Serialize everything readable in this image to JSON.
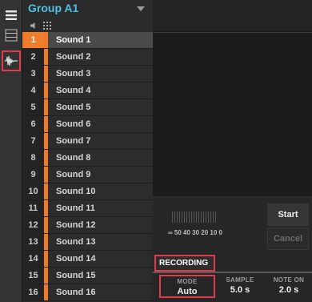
{
  "group": {
    "title": "Group A1"
  },
  "tools": [
    "menu-icon",
    "list-icon",
    "waveform-icon"
  ],
  "sounds": [
    {
      "num": "1",
      "name": "Sound 1",
      "selected": true
    },
    {
      "num": "2",
      "name": "Sound 2"
    },
    {
      "num": "3",
      "name": "Sound 3"
    },
    {
      "num": "4",
      "name": "Sound 4"
    },
    {
      "num": "5",
      "name": "Sound 5"
    },
    {
      "num": "6",
      "name": "Sound 6"
    },
    {
      "num": "7",
      "name": "Sound 7"
    },
    {
      "num": "8",
      "name": "Sound 8"
    },
    {
      "num": "9",
      "name": "Sound 9"
    },
    {
      "num": "10",
      "name": "Sound 10"
    },
    {
      "num": "11",
      "name": "Sound 11"
    },
    {
      "num": "12",
      "name": "Sound 12"
    },
    {
      "num": "13",
      "name": "Sound 13"
    },
    {
      "num": "14",
      "name": "Sound 14"
    },
    {
      "num": "15",
      "name": "Sound 15"
    },
    {
      "num": "16",
      "name": "Sound 16"
    }
  ],
  "meter": {
    "scale": "∞  50  40  30  20  10   0"
  },
  "buttons": {
    "start": "Start",
    "cancel": "Cancel"
  },
  "recording": {
    "label": "RECORDING",
    "mode": {
      "label": "MODE",
      "value": "Auto"
    },
    "sample": {
      "label": "SAMPLE",
      "value": "5.0 s"
    },
    "note_on": {
      "label": "NOTE ON",
      "value": "2.0 s"
    }
  },
  "colors": {
    "accent_blue": "#4ec3e8",
    "sound_orange": "#f07d2c",
    "highlight_red": "#e23a4a"
  }
}
